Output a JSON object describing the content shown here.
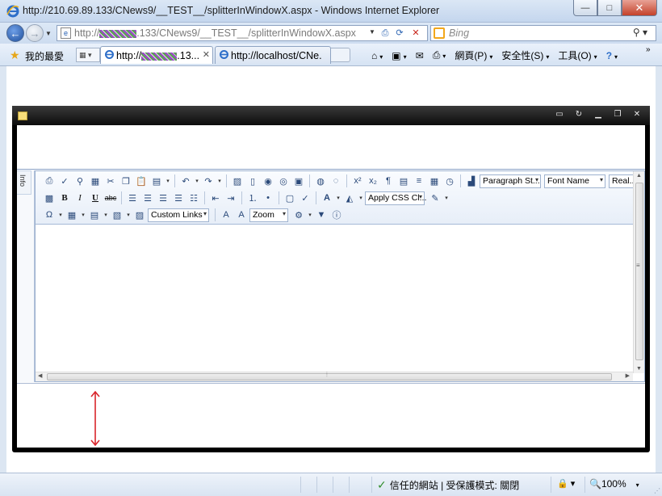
{
  "window": {
    "title": "http://210.69.89.133/CNews9/__TEST__/splitterInWindowX.aspx - Windows Internet Explorer",
    "minimize": "—",
    "maximize": "□",
    "close": "✕"
  },
  "address": {
    "url_prefix": "http://",
    "url_suffix": ".133/CNews9/__TEST__/splitterInWindowX.aspx",
    "search_placeholder": "Bing"
  },
  "favorites": {
    "label": "我的最愛"
  },
  "tabs": [
    {
      "prefix": "http://",
      "suffix": ".13..."
    },
    {
      "text": "http://localhost/CNe..."
    }
  ],
  "command_bar": {
    "page": "網頁(P)",
    "safety": "安全性(S)",
    "tools": "工具(O)"
  },
  "editor": {
    "side_tab": "Info",
    "paragraph_style": "Paragraph St...",
    "font_name": "Font Name",
    "real_font_size": "Real...",
    "apply_css": "Apply CSS Cl...",
    "custom_links": "Custom Links",
    "zoom": "Zoom"
  },
  "status": {
    "trust_text": "信任的網站 | 受保護模式: 關閉",
    "zoom": "100%"
  },
  "colors": {
    "resize_arrow": "#d9252b",
    "window_frame": "#000000",
    "bing_orange": "#f2a71b"
  }
}
